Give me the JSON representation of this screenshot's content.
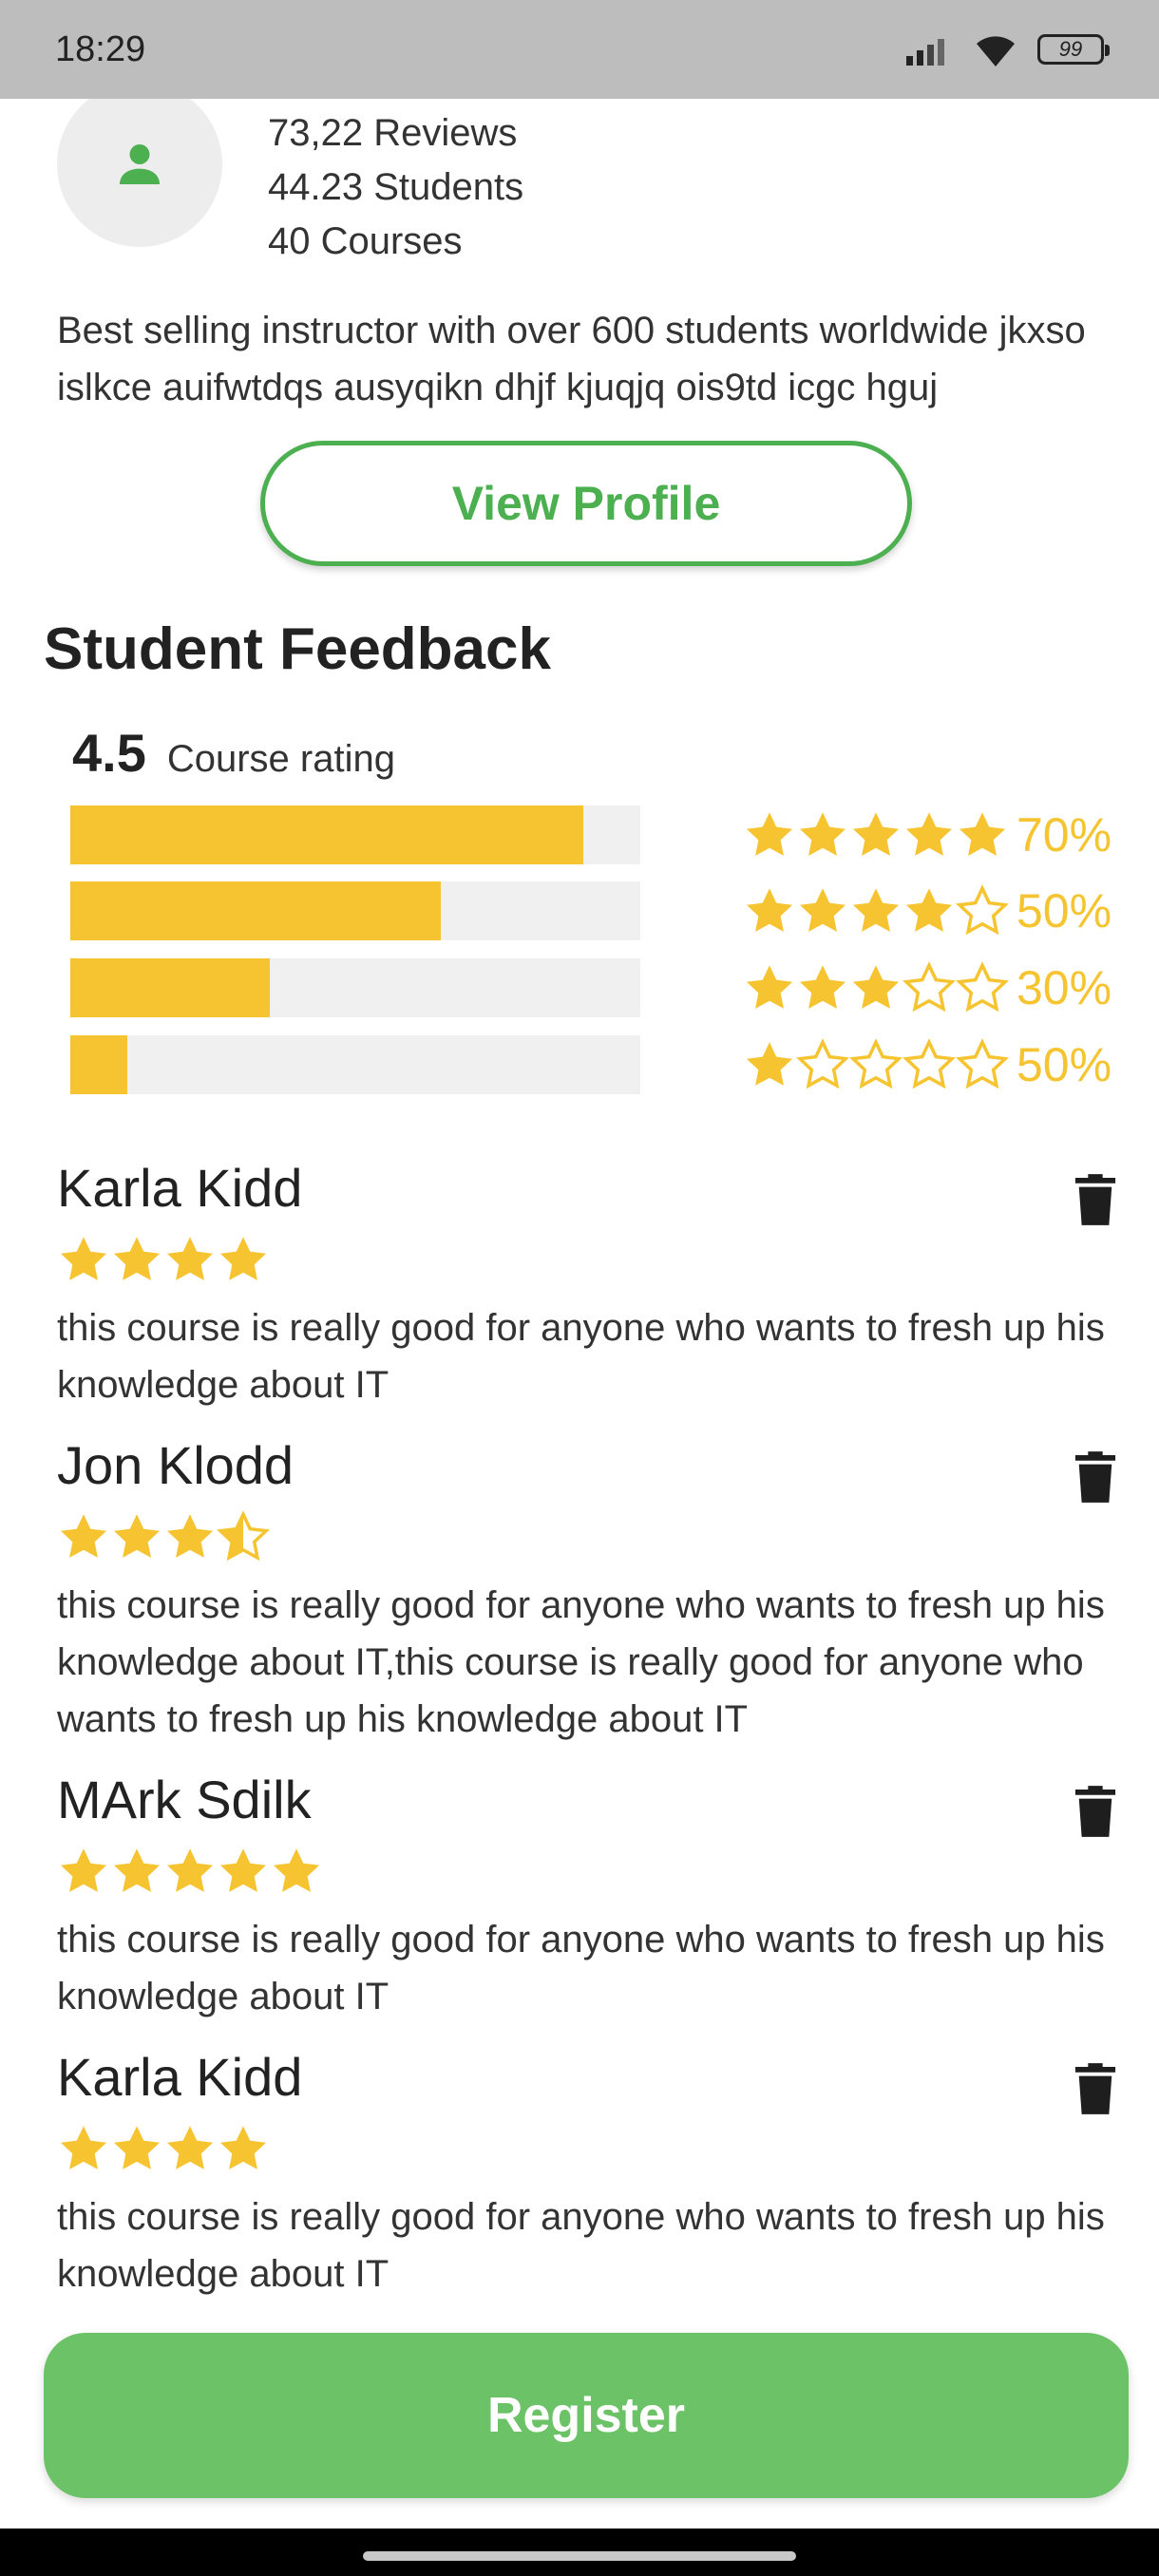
{
  "status_bar": {
    "time": "18:29",
    "battery": "99"
  },
  "instructor": {
    "stats": [
      "73,22 Reviews",
      "44.23 Students",
      "40 Courses"
    ],
    "bio": "Best selling instructor with over 600 students worldwide jkxso islkce auifwtdqs ausyqikn dhjf kjuqjq ois9td icgc hguj",
    "view_profile_label": "View Profile"
  },
  "feedback": {
    "title": "Student Feedback",
    "rating": "4.5",
    "rating_label": "Course rating",
    "breakdown": [
      {
        "stars": 5,
        "fill": 0.9,
        "percent": "70%"
      },
      {
        "stars": 4,
        "fill": 0.65,
        "percent": "50%"
      },
      {
        "stars": 3,
        "fill": 0.35,
        "percent": "30%"
      },
      {
        "stars": 1,
        "fill": 0.1,
        "percent": "50%"
      }
    ]
  },
  "reviews": [
    {
      "name": "Karla Kidd",
      "rating": 4,
      "text": "this course is really good for anyone who wants to fresh up his knowledge about IT"
    },
    {
      "name": "Jon Klodd",
      "rating": 3.5,
      "text": "this course is really good for anyone who wants to fresh up his knowledge about IT,this course is really good for anyone who wants to fresh up his knowledge about IT"
    },
    {
      "name": "MArk Sdilk",
      "rating": 5,
      "text": "this course is really good for anyone who wants to fresh up his knowledge about IT"
    },
    {
      "name": "Karla Kidd",
      "rating": 4,
      "text": "this course is really good for anyone who wants to fresh up his knowledge about IT"
    }
  ],
  "register_label": "Register",
  "colors": {
    "accent_green": "#4caf50",
    "register_green": "#6cc266",
    "star_yellow": "#f6c430"
  },
  "icons": [
    "person-icon",
    "star-icon",
    "trash-icon",
    "signal-icon",
    "wifi-icon",
    "battery-icon"
  ]
}
